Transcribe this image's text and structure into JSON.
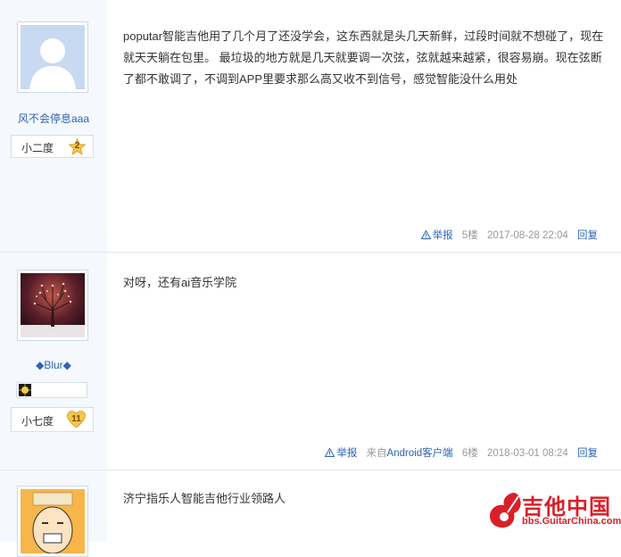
{
  "posts": [
    {
      "username": "风不会停息aaa",
      "rank": "小二度",
      "rank_level": "2",
      "content": "poputar智能吉他用了几个月了还没学会，这东西就是头几天新鲜，过段时间就不想碰了，现在就天天躺在包里。 最垃圾的地方就是几天就要调一次弦，弦就越来越紧，很容易崩。现在弦断了都不敢调了，不调到APP里要求那么高又收不到信号，感觉智能没什么用处",
      "report": "举报",
      "floor": "5楼",
      "time": "2017-08-28 22:04",
      "reply": "回复"
    },
    {
      "username": "◆Blur◆",
      "rank": "小七度",
      "rank_level": "11",
      "content": "对呀，还有ai音乐学院",
      "report": "举报",
      "source": "来自Android客户端",
      "floor": "6楼",
      "time": "2018-03-01 08:24",
      "reply": "回复"
    },
    {
      "content": "济宁指乐人智能吉他行业领路人"
    }
  ],
  "watermark": {
    "title": "吉他中国",
    "domain": "bbs.GuitarChina.com"
  },
  "colors": {
    "link": "#2d64b3",
    "side_bg": "#f5f8fd",
    "watermark": "#d9202a"
  }
}
